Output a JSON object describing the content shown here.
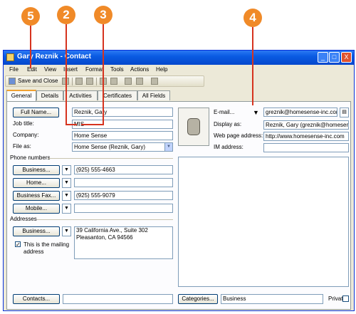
{
  "callouts": [
    "5",
    "2",
    "3",
    "4"
  ],
  "window": {
    "title": "Gary Reznik - Contact",
    "controls": [
      "_",
      "□",
      "X"
    ]
  },
  "menu": [
    "File",
    "Edit",
    "View",
    "Insert",
    "Format",
    "Tools",
    "Actions",
    "Help"
  ],
  "toolbar": {
    "save_close": "Save and Close",
    "icons": [
      "save-icon",
      "print-icon",
      "attach-icon",
      "flag-icon",
      "recurrence-icon",
      "delete-icon",
      "previous-icon",
      "next-icon",
      "address-book-icon"
    ]
  },
  "tabs": [
    "General",
    "Details",
    "Activities",
    "Certificates",
    "All Fields"
  ],
  "left": {
    "full_name_button": "Full Name...",
    "full_name_value": "Reznik, Gary",
    "job_title_label": "Job title:",
    "job_title_value": "MIS",
    "company_label": "Company:",
    "company_value": "Home Sense",
    "file_as_label": "File as:",
    "file_as_value": "Home Sense (Reznik, Gary)",
    "phone_section": "Phone numbers",
    "phones": [
      {
        "label": "Business...",
        "value": "(925) 555-4663"
      },
      {
        "label": "Home...",
        "value": ""
      },
      {
        "label": "Business Fax...",
        "value": "(925) 555-9079"
      },
      {
        "label": "Mobile...",
        "value": ""
      }
    ],
    "address_section": "Addresses",
    "address_button": "Business...",
    "address_value_line1": "39 California Ave., Suite 302",
    "address_value_line2": "Pleasanton, CA 94566",
    "mailing_line1": "This is the mailing",
    "mailing_line2": "address",
    "mailing_checked": true
  },
  "right": {
    "email_button": "E-mail...",
    "email_value": "greznik@homesense-inc.com",
    "display_as_label": "Display as:",
    "display_as_value": "Reznik, Gary (greznik@homesense-in",
    "web_label": "Web page address:",
    "web_value": "http://www.homesense-inc.com",
    "im_label": "IM address:",
    "im_value": ""
  },
  "bottom": {
    "contacts_button": "Contacts...",
    "contacts_value": "",
    "categories_button": "Categories...",
    "categories_value": "Business",
    "private_label": "Private"
  },
  "colors": {
    "callout": "#f08a28",
    "lead_line": "#d6331e",
    "title_bar": "#0a5be3",
    "window_bg": "#ece9d8"
  }
}
